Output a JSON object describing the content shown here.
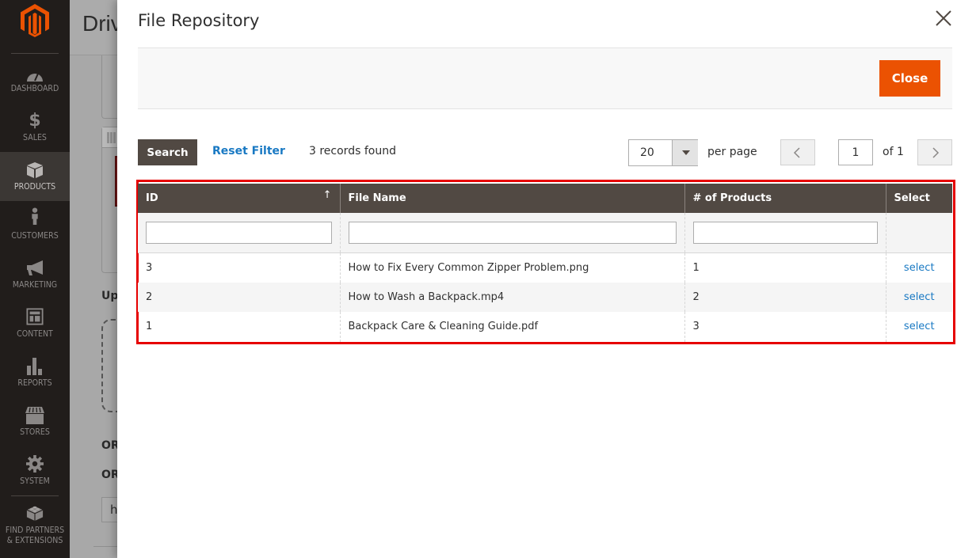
{
  "sidebar": {
    "logo": "magento-logo",
    "items": [
      {
        "label": "DASHBOARD",
        "icon": "dashboard-gauge-icon",
        "active": false
      },
      {
        "label": "SALES",
        "icon": "dollar-icon",
        "active": false
      },
      {
        "label": "PRODUCTS",
        "icon": "box-icon",
        "active": true
      },
      {
        "label": "CUSTOMERS",
        "icon": "person-icon",
        "active": false
      },
      {
        "label": "MARKETING",
        "icon": "megaphone-icon",
        "active": false
      },
      {
        "label": "CONTENT",
        "icon": "layout-icon",
        "active": false
      },
      {
        "label": "REPORTS",
        "icon": "bar-chart-icon",
        "active": false
      },
      {
        "label": "STORES",
        "icon": "storefront-icon",
        "active": false
      },
      {
        "label": "SYSTEM",
        "icon": "gear-icon",
        "active": false
      },
      {
        "label_line1": "FIND PARTNERS",
        "label_line2": "& EXTENSIONS",
        "icon": "lego-brick-icon",
        "active": false
      }
    ]
  },
  "background_page": {
    "title": "Driv",
    "upload_label": "Up",
    "or_label_1": "OR",
    "or_label_2": "OR",
    "input_value": "h"
  },
  "modal": {
    "title": "File Repository",
    "close_label": "Close",
    "toolbar": {
      "search_label": "Search",
      "reset_label": "Reset Filter",
      "records_found": "3 records found",
      "per_page_value": "20",
      "per_page_label": "per page",
      "current_page": "1",
      "total_pages_label": "of 1"
    },
    "grid": {
      "columns": [
        "ID",
        "File Name",
        "# of Products",
        "Select"
      ],
      "sort_indicator": "↑",
      "rows": [
        {
          "id": "3",
          "file_name": "How to Fix Every Common Zipper Problem.png",
          "products": "1",
          "action": "select"
        },
        {
          "id": "2",
          "file_name": "How to Wash a Backpack.mp4",
          "products": "2",
          "action": "select"
        },
        {
          "id": "1",
          "file_name": "Backpack Care & Cleaning Guide.pdf",
          "products": "3",
          "action": "select"
        }
      ]
    }
  },
  "colors": {
    "accent_orange": "#eb5202",
    "header_brown": "#514943",
    "link_blue": "#1979c3",
    "highlight_red": "#e60000",
    "sidebar_bg": "#211d1b"
  }
}
